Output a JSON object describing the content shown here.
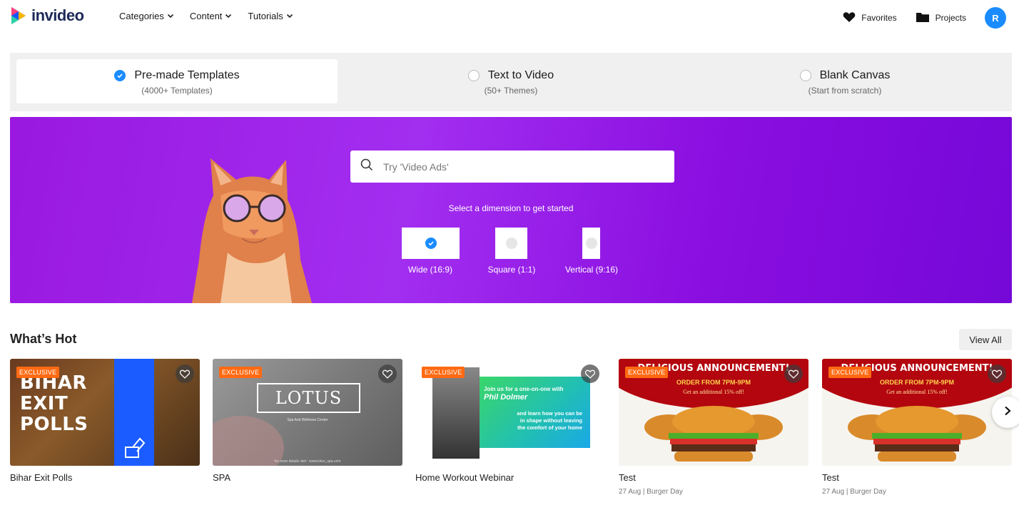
{
  "app": {
    "logo_text": "invideo"
  },
  "nav": {
    "menu": [
      {
        "label": "Categories"
      },
      {
        "label": "Content"
      },
      {
        "label": "Tutorials"
      }
    ],
    "favorites_label": "Favorites",
    "projects_label": "Projects",
    "avatar_initial": "R"
  },
  "modes": [
    {
      "title": "Pre-made Templates",
      "subtitle": "(4000+ Templates)",
      "selected": true
    },
    {
      "title": "Text to Video",
      "subtitle": "(50+ Themes)",
      "selected": false
    },
    {
      "title": "Blank Canvas",
      "subtitle": "(Start from scratch)",
      "selected": false
    }
  ],
  "hero": {
    "search_placeholder": "Try 'Video Ads'",
    "dimension_prompt": "Select a dimension to get started",
    "dimensions": [
      {
        "label": "Wide (16:9)",
        "selected": true
      },
      {
        "label": "Square (1:1)",
        "selected": false
      },
      {
        "label": "Vertical (9:16)",
        "selected": false
      }
    ]
  },
  "whats_hot": {
    "title": "What’s Hot",
    "view_all_label": "View All",
    "cards": [
      {
        "title": "Bihar Exit Polls",
        "meta": "",
        "badge": "EXCLUSIVE",
        "thumb_text": [
          "BIHAR",
          "EXIT",
          "POLLS"
        ]
      },
      {
        "title": "SPA",
        "meta": "",
        "badge": "EXCLUSIVE",
        "thumb_text": [
          "LOTUS",
          "Spa And Wellness Center",
          "for more details visit : www.lotus_spa.com"
        ]
      },
      {
        "title": "Home Workout Webinar",
        "meta": "",
        "badge": "EXCLUSIVE",
        "thumb_text": [
          "Join us for a one-on-one with",
          "Phil Dolmer",
          "and learn how you can be in shape without leaving the comfort of your home"
        ]
      },
      {
        "title": "Test",
        "meta": "27 Aug | Burger Day",
        "badge": "EXCLUSIVE",
        "thumb_text": [
          "DELICIOUS ANNOUNCEMENT!",
          "ORDER FROM 7PM-9PM",
          "Get an additional 15% off!"
        ]
      },
      {
        "title": "Test",
        "meta": "27 Aug | Burger Day",
        "badge": "EXCLUSIVE",
        "thumb_text": [
          "DELICIOUS ANNOUNCEMENT!",
          "ORDER FROM 7PM-9PM",
          "Get an additional 15% off!"
        ]
      }
    ]
  },
  "colors": {
    "accent": "#1a8cff",
    "hero_purple": "#9a18e0",
    "badge_orange": "#ff6a13"
  }
}
